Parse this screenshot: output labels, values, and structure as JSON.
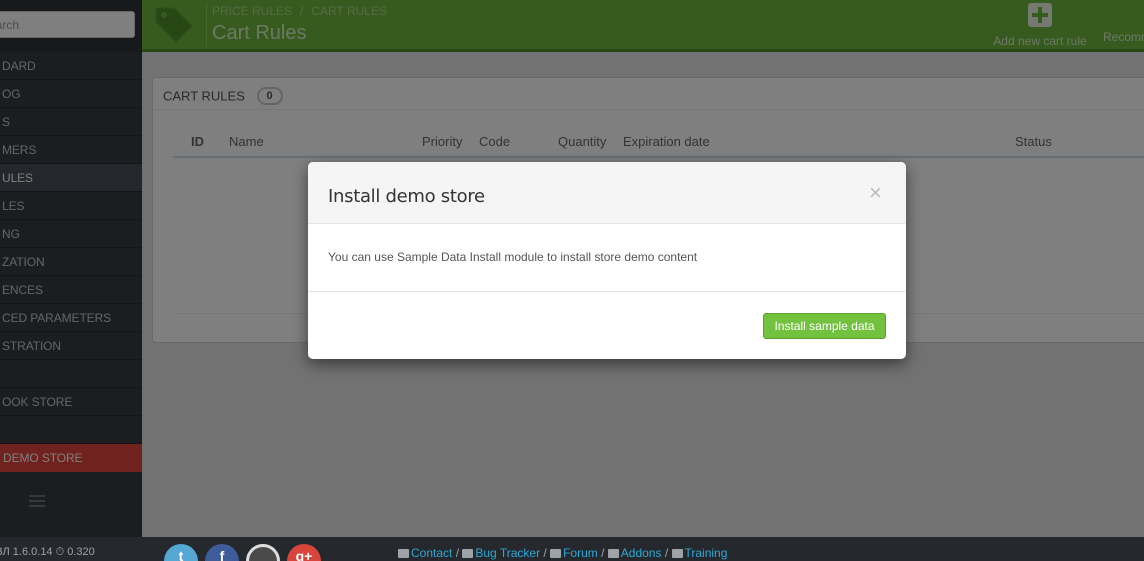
{
  "sidebar": {
    "search_placeholder": "earch",
    "items": [
      {
        "label": "DARD",
        "state": "normal"
      },
      {
        "label": "OG",
        "state": "normal"
      },
      {
        "label": "S",
        "state": "normal"
      },
      {
        "label": "MERS",
        "state": "normal"
      },
      {
        "label": "ULES",
        "state": "active"
      },
      {
        "label": "LES",
        "state": "normal"
      },
      {
        "label": "NG",
        "state": "normal"
      },
      {
        "label": "ZATION",
        "state": "normal"
      },
      {
        "label": "ENCES",
        "state": "normal"
      },
      {
        "label": "CED PARAMETERS",
        "state": "normal"
      },
      {
        "label": "STRATION",
        "state": "normal"
      },
      {
        "label": "",
        "state": "empty"
      },
      {
        "label": "OOK STORE",
        "state": "normal"
      },
      {
        "label": "",
        "state": "empty"
      },
      {
        "label": "DEMO STORE",
        "state": "demo"
      }
    ],
    "bottom_text": "ЗЛ 1.6.0.14   ⏱ 0.320"
  },
  "header": {
    "breadcrumb": [
      "PRICE RULES",
      "CART RULES"
    ],
    "title": "Cart Rules",
    "toolbar": {
      "add_label": "Add new cart rule",
      "recommended_label": "Recomm"
    },
    "accent_color": "#6fb43c"
  },
  "panel": {
    "title": "CART RULES",
    "count": "0",
    "columns": [
      "ID",
      "Name",
      "Priority",
      "Code",
      "Quantity",
      "Expiration date",
      "Status"
    ]
  },
  "modal": {
    "title": "Install demo store",
    "close": "×",
    "body": "You can use Sample Data Install module to install store demo content",
    "button": "Install sample data",
    "button_color": "#72c13f"
  },
  "footer": {
    "social": [
      "twitter-icon",
      "facebook-icon",
      "github-icon",
      "google-plus-icon"
    ],
    "links": [
      "Contact",
      "Bug Tracker",
      "Forum",
      "Addons",
      "Training"
    ]
  }
}
